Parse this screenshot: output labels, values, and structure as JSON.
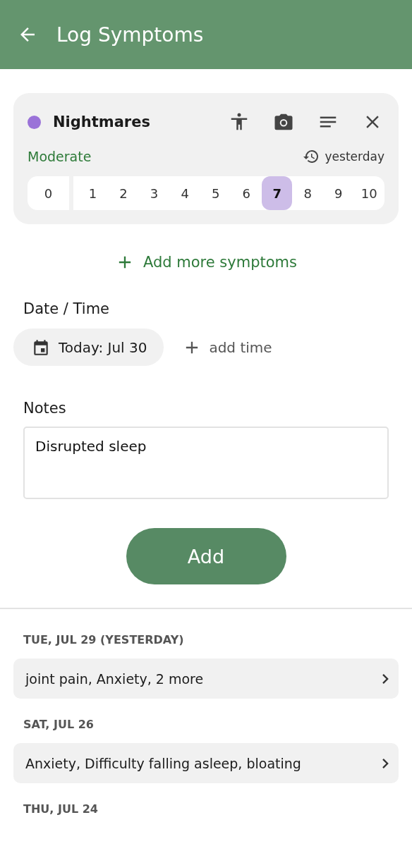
{
  "app_bar": {
    "title": "Log Symptoms"
  },
  "symptom": {
    "name": "Nightmares",
    "color": "#9a72d8",
    "severity_label": "Moderate",
    "recent": "yesterday",
    "scale": [
      {
        "label": "0",
        "selected": false
      },
      {
        "label": "1",
        "selected": false
      },
      {
        "label": "2",
        "selected": false
      },
      {
        "label": "3",
        "selected": false
      },
      {
        "label": "4",
        "selected": false
      },
      {
        "label": "5",
        "selected": false
      },
      {
        "label": "6",
        "selected": false
      },
      {
        "label": "7",
        "selected": true
      },
      {
        "label": "8",
        "selected": false
      },
      {
        "label": "9",
        "selected": false
      },
      {
        "label": "10",
        "selected": false
      }
    ]
  },
  "add_more": "Add more symptoms",
  "date_time": {
    "label": "Date / Time",
    "date": "Today: Jul 30",
    "add_time": "add time"
  },
  "notes": {
    "label": "Notes",
    "value": "Disrupted sleep"
  },
  "submit": "Add",
  "history": [
    {
      "date": "TUE, JUL 29 (YESTERDAY)",
      "summary": "joint pain, Anxiety, 2 more"
    },
    {
      "date": "SAT, JUL 26",
      "summary": "Anxiety, Difficulty falling asleep, bloating"
    },
    {
      "date": "THU, JUL 24"
    }
  ]
}
